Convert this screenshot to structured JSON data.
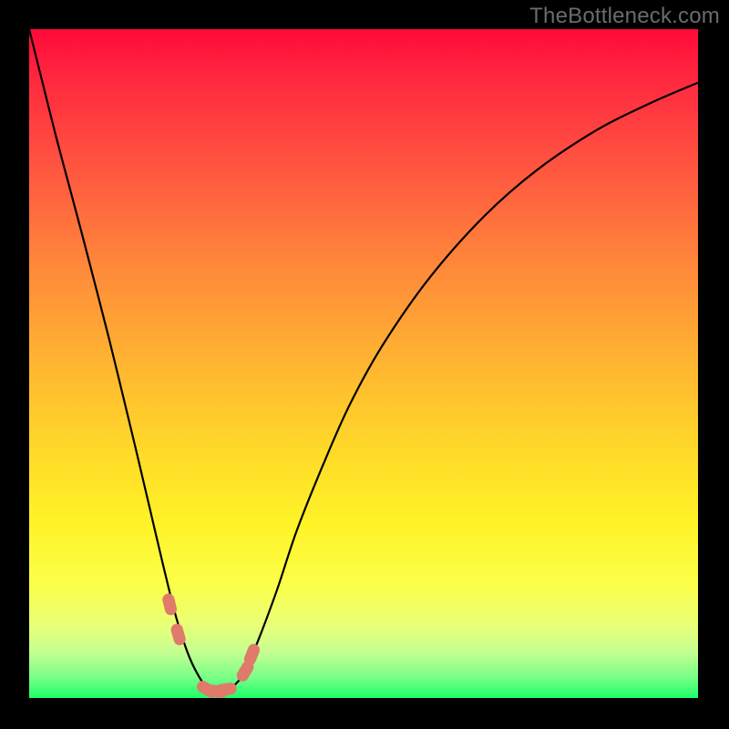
{
  "watermark": "TheBottleneck.com",
  "chart_data": {
    "type": "line",
    "title": "",
    "xlabel": "",
    "ylabel": "",
    "xlim": [
      0,
      100
    ],
    "ylim": [
      0,
      100
    ],
    "series": [
      {
        "name": "bottleneck-curve",
        "x": [
          0,
          2,
          4,
          6,
          8,
          10,
          12,
          14,
          16,
          18,
          20,
          22,
          24,
          26,
          27,
          28,
          29,
          30,
          32,
          34,
          37,
          40,
          44,
          48,
          53,
          60,
          68,
          76,
          85,
          93,
          100
        ],
        "values": [
          100,
          92,
          84,
          76.5,
          69,
          61.3,
          53.5,
          45.3,
          37,
          28.5,
          20,
          12,
          6,
          2.2,
          1.3,
          1,
          1,
          1.3,
          3.5,
          8,
          16,
          25,
          35,
          44,
          53,
          63,
          72,
          79,
          85,
          89,
          92
        ]
      }
    ],
    "markers": [
      {
        "name": "marker-left-upper",
        "x": 21.0,
        "y": 14.0
      },
      {
        "name": "marker-left-mid",
        "x": 22.3,
        "y": 9.5
      },
      {
        "name": "marker-bottom-1",
        "x": 26.6,
        "y": 1.3
      },
      {
        "name": "marker-bottom-2",
        "x": 28.0,
        "y": 1.0
      },
      {
        "name": "marker-bottom-3",
        "x": 29.4,
        "y": 1.3
      },
      {
        "name": "marker-right-lower",
        "x": 32.3,
        "y": 4.0
      },
      {
        "name": "marker-right-upper",
        "x": 33.3,
        "y": 6.5
      }
    ],
    "marker_style": {
      "color": "#e07a6b",
      "radius_px": 12
    }
  }
}
